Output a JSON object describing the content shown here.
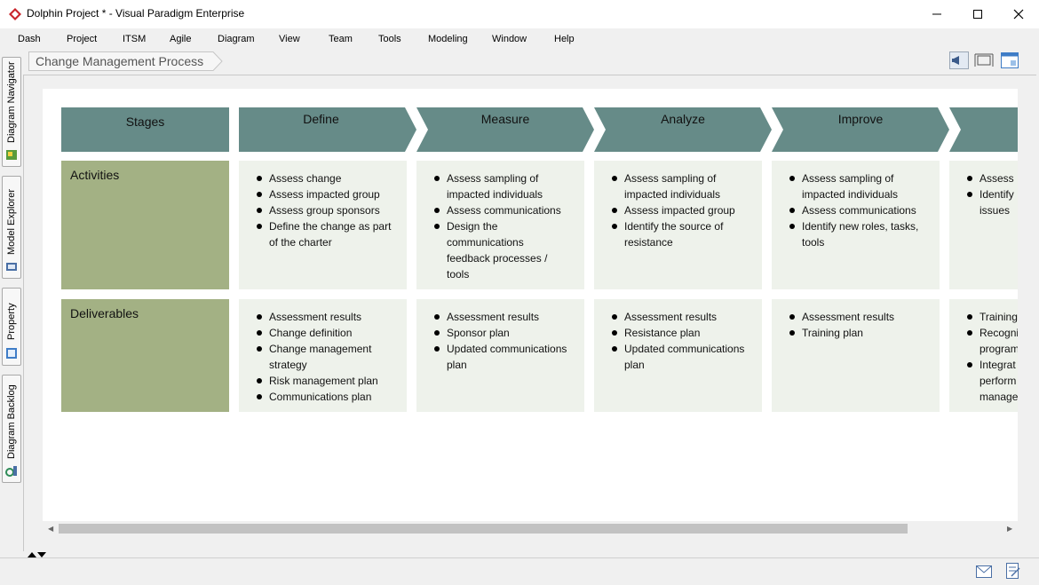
{
  "window": {
    "title": "Dolphin Project * - Visual Paradigm Enterprise",
    "colors": {
      "accent": "#c9252c"
    },
    "icons": [
      "app-logo-icon",
      "minimize-icon",
      "maximize-icon",
      "close-icon"
    ]
  },
  "menu": [
    "Dash",
    "Project",
    "ITSM",
    "Agile",
    "Diagram",
    "View",
    "Team",
    "Tools",
    "Modeling",
    "Window",
    "Help"
  ],
  "side_tabs": [
    {
      "label": "Diagram Navigator"
    },
    {
      "label": "Model Explorer"
    },
    {
      "label": "Property"
    },
    {
      "label": "Diagram Backlog"
    }
  ],
  "breadcrumb": {
    "label": "Change Management Process"
  },
  "toolbar_icons": [
    "announcement-icon",
    "fit-diagram-icon",
    "diagram-panel-icon"
  ],
  "diagram": {
    "colors": {
      "header": "#668b88",
      "row_label": "#a3b184",
      "cell": "#eef2eb"
    },
    "stage_label": "Stages",
    "stages": [
      {
        "name": "Define"
      },
      {
        "name": "Measure"
      },
      {
        "name": "Analyze"
      },
      {
        "name": "Improve"
      },
      {
        "name": ""
      }
    ],
    "rows": [
      {
        "label": "Activities",
        "cells": [
          [
            "Assess change",
            "Assess impacted group",
            "Assess group sponsors",
            "Define the change as part\nof the charter"
          ],
          [
            "Assess sampling of\nimpacted individuals",
            "Assess communications",
            "Design the\ncommunications\nfeedback processes /\ntools"
          ],
          [
            "Assess sampling of\nimpacted individuals",
            "Assess impacted group",
            "Identify the source of\nresistance"
          ],
          [
            "Assess sampling of\nimpacted individuals",
            "Assess communications",
            "Identify new roles, tasks,\ntools"
          ],
          [
            "Assess",
            "Identify\nissues"
          ]
        ]
      },
      {
        "label": "Deliverables",
        "cells": [
          [
            "Assessment results",
            "Change definition",
            "Change management\nstrategy",
            "Risk management plan",
            "Communications plan"
          ],
          [
            "Assessment results",
            "Sponsor plan",
            "Updated communications\nplan"
          ],
          [
            "Assessment results",
            "Resistance plan",
            "Updated communications\nplan"
          ],
          [
            "Assessment results",
            "Training plan"
          ],
          [
            "Training",
            "Recogni\nprogram",
            "Integrat\nperform\nmanage"
          ]
        ]
      }
    ]
  },
  "status_icons": [
    "mail-icon",
    "notes-icon"
  ]
}
